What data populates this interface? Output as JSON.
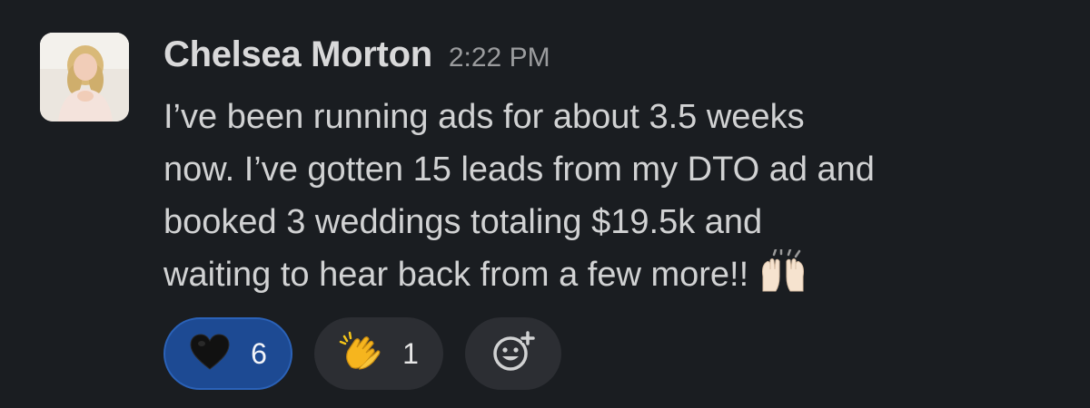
{
  "message": {
    "author": "Chelsea Morton",
    "timestamp": "2:22 PM",
    "lines": [
      "I’ve been running ads for about 3.5 weeks",
      "now. I’ve gotten 15 leads from my DTO ad and",
      "booked 3 weddings totaling $19.5k and",
      "waiting to hear back from a few more!!"
    ],
    "trailing_emoji": "raised-hands-icon"
  },
  "reactions": [
    {
      "icon": "black-heart-icon",
      "count": "6",
      "selected": true,
      "color": "#1d4a93"
    },
    {
      "icon": "clapping-hands-icon",
      "count": "1",
      "selected": false,
      "color": "#2c2e33"
    },
    {
      "icon": "add-reaction-icon",
      "selected": false,
      "color": "#2c2e33"
    }
  ],
  "colors": {
    "background": "#1a1d21",
    "text": "#d1d2d3",
    "muted": "#9b9c9e",
    "selected_reaction": "#1d4a93",
    "reaction_bg": "#2c2e33"
  }
}
